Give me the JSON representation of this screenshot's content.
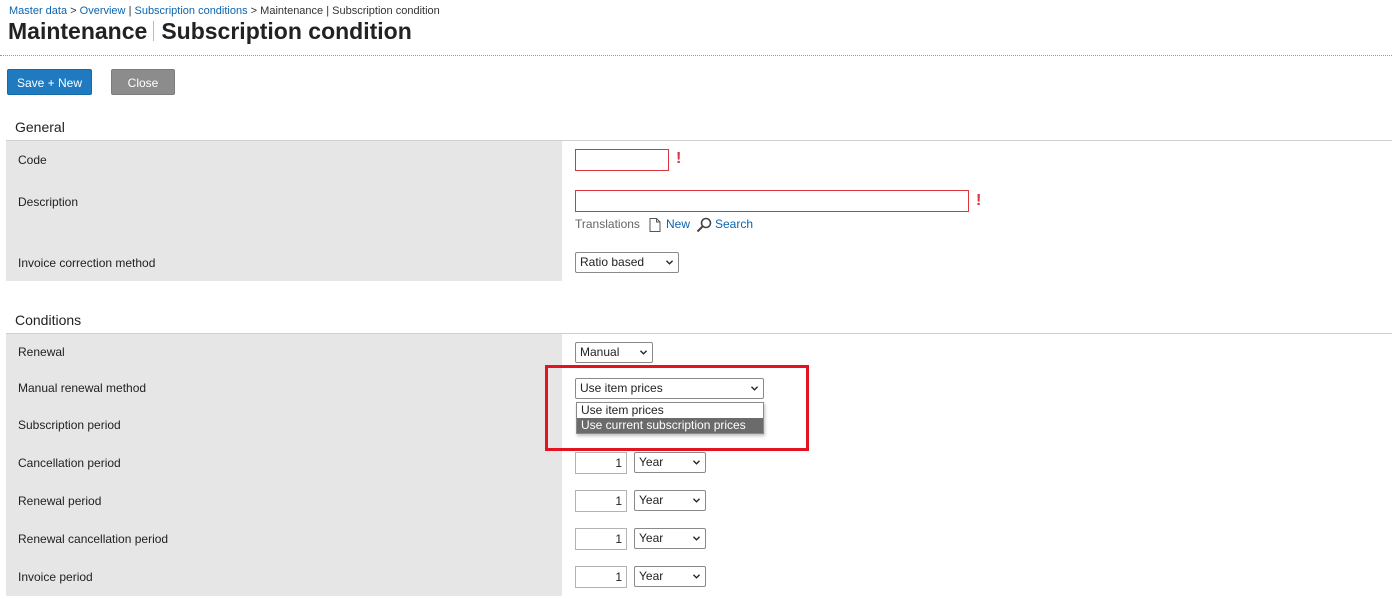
{
  "breadcrumb": {
    "master_data": "Master data",
    "sep1": ">",
    "overview": "Overview",
    "pipe": "|",
    "subscription_conditions": "Subscription conditions",
    "sep2": ">",
    "current": "Maintenance | Subscription condition"
  },
  "title": {
    "part1": "Maintenance",
    "part2": "Subscription condition"
  },
  "toolbar": {
    "save_new": "Save + New",
    "close": "Close"
  },
  "general": {
    "title": "General",
    "code_label": "Code",
    "code_value": "",
    "description_label": "Description",
    "description_value": "",
    "required_mark": "!",
    "translations_label": "Translations",
    "new_link": "New",
    "search_link": "Search",
    "invoice_correction_label": "Invoice correction method",
    "invoice_correction_value": "Ratio based"
  },
  "conditions": {
    "title": "Conditions",
    "renewal_label": "Renewal",
    "renewal_value": "Manual",
    "manual_renewal_label": "Manual renewal method",
    "manual_renewal_value": "Use item prices",
    "manual_renewal_options": [
      "Use item prices",
      "Use current subscription prices"
    ],
    "subscription_period_label": "Subscription period",
    "cancellation_period_label": "Cancellation period",
    "cancellation_period_value": "1",
    "cancellation_period_unit": "Year",
    "renewal_period_label": "Renewal period",
    "renewal_period_value": "1",
    "renewal_period_unit": "Year",
    "renewal_cancellation_label": "Renewal cancellation period",
    "renewal_cancellation_value": "1",
    "renewal_cancellation_unit": "Year",
    "invoice_period_label": "Invoice period",
    "invoice_period_value": "1",
    "invoice_period_unit": "Year"
  },
  "colors": {
    "accent": "#1f7ac0",
    "link": "#0b64b0",
    "required": "#d9363e",
    "highlight": "#e1141f"
  }
}
